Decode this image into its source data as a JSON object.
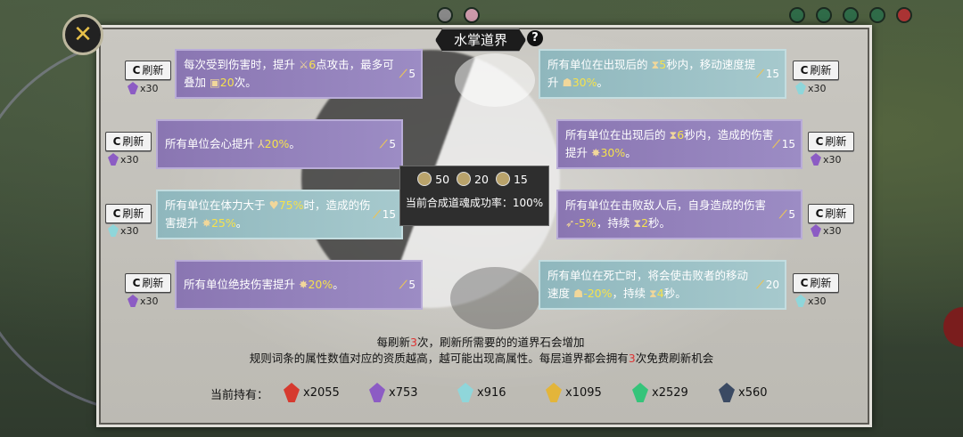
{
  "title": "水掌道界",
  "help_label": "?",
  "close_label": "✕",
  "refresh_label": "刷新",
  "refresh_glyph": "C",
  "center": {
    "stats": [
      {
        "icon": "sword-stat-icon",
        "value": "50"
      },
      {
        "icon": "coin-stat-icon",
        "value": "20"
      },
      {
        "icon": "shield-stat-icon",
        "value": "15"
      }
    ],
    "rate_text": "当前合成道魂成功率：100%"
  },
  "left_cards": [
    {
      "segments": [
        "每次受到伤害时，提升 ",
        "⚔",
        "6",
        "点攻击，最多可叠加 ",
        "▣",
        "20",
        "次。"
      ],
      "cost": "5",
      "refresh_cost": "x30",
      "gem": "purple",
      "style": "purple"
    },
    {
      "segments": [
        "所有单位会心提升 ",
        "⅄",
        "20%",
        "。",
        "",
        "",
        ""
      ],
      "cost": "5",
      "refresh_cost": "x30",
      "gem": "purple",
      "style": "purple"
    },
    {
      "segments": [
        "所有单位在体力大于 ",
        "♥",
        "75%",
        "时，造成的伤害提升 ",
        "✸",
        "25%",
        "。"
      ],
      "cost": "15",
      "refresh_cost": "x30",
      "gem": "cyan",
      "style": "blue"
    },
    {
      "segments": [
        "所有单位绝技伤害提升 ",
        "✸",
        "20%",
        "。",
        "",
        "",
        ""
      ],
      "cost": "5",
      "refresh_cost": "x30",
      "gem": "purple",
      "style": "purple"
    }
  ],
  "right_cards": [
    {
      "segments": [
        "所有单位在出现后的 ",
        "⧗",
        "5",
        "秒内，移动速度提升 ",
        "☗",
        "30%",
        "。"
      ],
      "cost": "15",
      "refresh_cost": "x30",
      "gem": "cyan",
      "style": "blue"
    },
    {
      "segments": [
        "所有单位在出现后的 ",
        "⧗",
        "6",
        "秒内，造成的伤害提升 ",
        "✸",
        "30%",
        "。"
      ],
      "cost": "15",
      "refresh_cost": "x30",
      "gem": "purple",
      "style": "purple"
    },
    {
      "segments": [
        "所有单位在击败敌人后，自身造成的伤害 ",
        "➶",
        "-5%",
        "，持续 ",
        "⧗",
        "2",
        "秒。"
      ],
      "cost": "5",
      "refresh_cost": "x30",
      "gem": "purple",
      "style": "purple"
    },
    {
      "segments": [
        "所有单位在死亡时，将会使击败者的移动速度 ",
        "☗",
        "-20%",
        "，持续 ",
        "⧗",
        "4",
        "秒。"
      ],
      "cost": "20",
      "refresh_cost": "x30",
      "gem": "cyan",
      "style": "blue"
    }
  ],
  "info": {
    "line1_pre": "每刷新",
    "line1_num": "3",
    "line1_post": "次，刷新所需要的的道界石会增加",
    "line2_pre": "规则词条的属性数值对应的资质越高，越可能出现高属性。每层道界都会拥有",
    "line2_num": "3",
    "line2_post": "次免费刷新机会"
  },
  "holdings_label": "当前持有：",
  "holdings": [
    {
      "gem": "red",
      "count": "x2055"
    },
    {
      "gem": "purple",
      "count": "x753"
    },
    {
      "gem": "cyan",
      "count": "x916"
    },
    {
      "gem": "gold",
      "count": "x1095"
    },
    {
      "gem": "green",
      "count": "x2529"
    },
    {
      "gem": "dark",
      "count": "x560"
    }
  ],
  "colors": {
    "purple_card": "#8a76b2",
    "blue_card": "#8fb7bd",
    "highlight": "#f6e24b",
    "gem_red": "#d63a2f",
    "gem_purple": "#8c5cc4",
    "gem_cyan": "#8fd6da",
    "gem_gold": "#e3b53a",
    "gem_green": "#35c47a",
    "gem_dark": "#3b4a63"
  }
}
